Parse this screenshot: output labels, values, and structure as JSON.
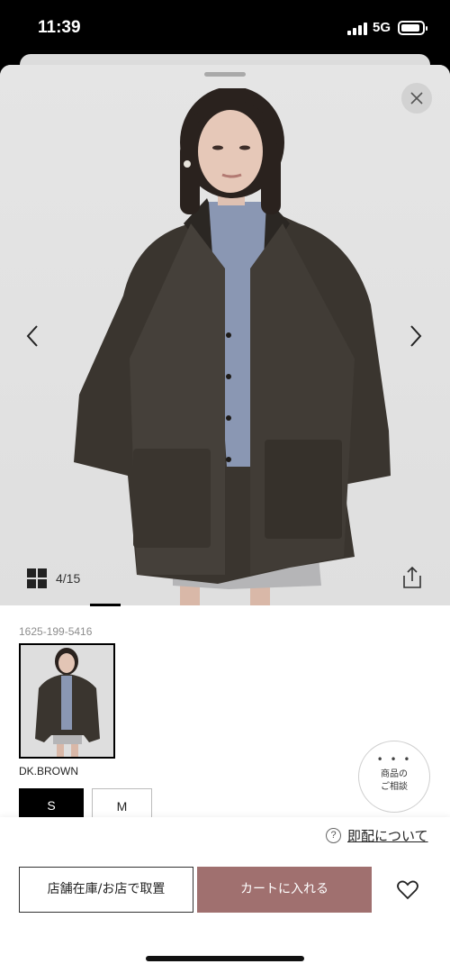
{
  "status_bar": {
    "time": "11:39",
    "network": "5G"
  },
  "gallery": {
    "counter": "4/15"
  },
  "product": {
    "sku": "1625-199-5416",
    "color_name": "DK.BROWN",
    "sizes": [
      "S",
      "M"
    ],
    "selected_size": "S"
  },
  "consult": {
    "label_line1": "商品の",
    "label_line2": "ご相談"
  },
  "actions": {
    "delivery_help": "即配について",
    "store_button": "店舗在庫/お店で取置",
    "cart_button": "カートに入れる"
  },
  "colors": {
    "cart_accent": "#a0706f",
    "selected_size_bg": "#000000"
  },
  "icons": [
    "close-icon",
    "chevron-left-icon",
    "chevron-right-icon",
    "grid-view-icon",
    "share-icon",
    "more-dots-icon",
    "question-icon",
    "heart-icon"
  ]
}
